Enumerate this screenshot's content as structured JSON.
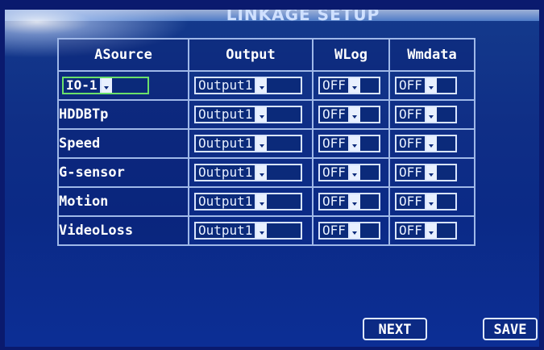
{
  "title": "LINKAGE SETUP",
  "columns": [
    "ASource",
    "Output",
    "WLog",
    "Wmdata"
  ],
  "rows": [
    {
      "source": "IO-1",
      "output": "Output1",
      "wlog": "OFF",
      "wmdata": "OFF"
    },
    {
      "source": "HDDBTp",
      "output": "Output1",
      "wlog": "OFF",
      "wmdata": "OFF"
    },
    {
      "source": "Speed",
      "output": "Output1",
      "wlog": "OFF",
      "wmdata": "OFF"
    },
    {
      "source": "G-sensor",
      "output": "Output1",
      "wlog": "OFF",
      "wmdata": "OFF"
    },
    {
      "source": "Motion",
      "output": "Output1",
      "wlog": "OFF",
      "wmdata": "OFF"
    },
    {
      "source": "VideoLoss",
      "output": "Output1",
      "wlog": "OFF",
      "wmdata": "OFF"
    }
  ],
  "buttons": {
    "next": "NEXT",
    "save": "SAVE"
  },
  "colors": {
    "background": "#0f2e86",
    "grid_line": "#9fb8e8",
    "focus": "#6ae06a"
  }
}
